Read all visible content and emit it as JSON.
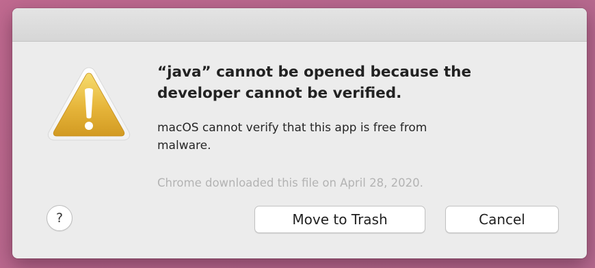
{
  "dialog": {
    "heading": "“java” cannot be opened because the developer cannot be verified.",
    "message": "macOS cannot verify that this app is free from malware.",
    "footnote": "Chrome downloaded this file on April 28, 2020.",
    "icon": "warning-triangle-icon"
  },
  "buttons": {
    "help_label": "?",
    "move_to_trash_label": "Move to Trash",
    "cancel_label": "Cancel"
  },
  "colors": {
    "desktop_background": "#b8688e",
    "dialog_background": "#ececec",
    "warning_yellow": "#e6b53a",
    "footnote_gray": "#b3b3b3"
  }
}
